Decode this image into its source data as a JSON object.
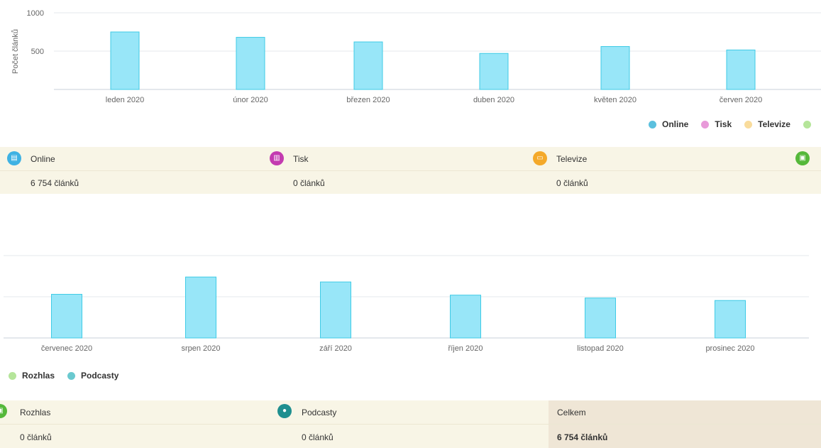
{
  "colors": {
    "Online": "#5bc0de",
    "Tisk": "#e05fbf",
    "Televize": "#f7c25f",
    "Rozhlas": "#9bd86c",
    "Podcasty": "#4fb8b8",
    "bar_fill": "#98e6f8",
    "bar_stroke": "#3fcbe6"
  },
  "chart_data": [
    {
      "type": "bar",
      "ylabel": "Počet článků",
      "ylim": [
        0,
        1000
      ],
      "yticks": [
        500,
        1000
      ],
      "categories": [
        "leden 2020",
        "únor 2020",
        "březen 2020",
        "duben 2020",
        "květen 2020",
        "červen 2020"
      ],
      "series": [
        {
          "name": "Online",
          "values": [
            750,
            680,
            620,
            470,
            560,
            515
          ]
        }
      ],
      "legend": [
        "Online",
        "Tisk",
        "Televize"
      ]
    },
    {
      "type": "bar",
      "ylim": [
        0,
        1000
      ],
      "yticks": [],
      "categories": [
        "červenec 2020",
        "srpen 2020",
        "září 2020",
        "říjen 2020",
        "listopad 2020",
        "prosinec 2020"
      ],
      "series": [
        {
          "name": "Online",
          "values": [
            530,
            740,
            680,
            520,
            485,
            455
          ]
        }
      ],
      "legend": [
        "Rozhlas",
        "Podcasty"
      ]
    }
  ],
  "summary_top": [
    {
      "label": "Online",
      "value": "6 754 článků",
      "icon": "newspaper-icon"
    },
    {
      "label": "Tisk",
      "value": "0 článků",
      "icon": "print-icon"
    },
    {
      "label": "Televize",
      "value": "0 článků",
      "icon": "tv-icon"
    },
    {
      "label": "",
      "value": "",
      "icon": "radio-icon"
    }
  ],
  "summary_bottom": [
    {
      "label": "Rozhlas",
      "value": "0 článků",
      "icon": "radio-icon"
    },
    {
      "label": "Podcasty",
      "value": "0 článků",
      "icon": "microphone-icon"
    },
    {
      "label": "Celkem",
      "value": "6 754 článků"
    }
  ]
}
